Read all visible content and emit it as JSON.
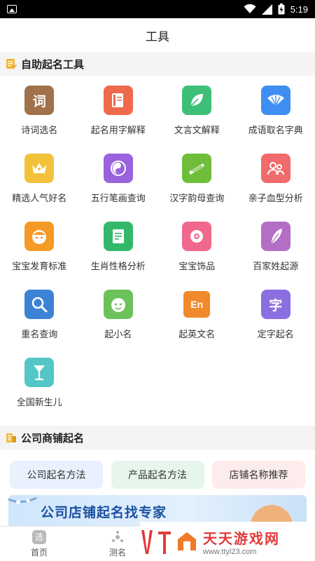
{
  "status_bar": {
    "time": "5:19"
  },
  "app_bar": {
    "title": "工具"
  },
  "section_self": {
    "title": "自助起名工具",
    "tools": [
      {
        "label": "诗词选名",
        "glyph": "词",
        "color": "#a0714a",
        "icon": "book-icon"
      },
      {
        "label": "起名用字解释",
        "glyph": "",
        "color": "#ef6a4c",
        "icon": "dictionary-icon"
      },
      {
        "label": "文言文解释",
        "glyph": "",
        "color": "#3ebf77",
        "icon": "leaf-icon"
      },
      {
        "label": "成语取名字典",
        "glyph": "",
        "color": "#3f8ef2",
        "icon": "fan-icon"
      },
      {
        "label": "精选人气好名",
        "glyph": "",
        "color": "#f3c23b",
        "icon": "crown-icon"
      },
      {
        "label": "五行笔画查询",
        "glyph": "",
        "color": "#9a63dd",
        "icon": "bagua-icon"
      },
      {
        "label": "汉字韵母查询",
        "glyph": "",
        "color": "#6fbe3b",
        "icon": "zither-icon"
      },
      {
        "label": "亲子血型分析",
        "glyph": "",
        "color": "#f06b6b",
        "icon": "family-icon"
      },
      {
        "label": "宝宝发育标准",
        "glyph": "",
        "color": "#f59a27",
        "icon": "baby-face-icon"
      },
      {
        "label": "生肖性格分析",
        "glyph": "",
        "color": "#33b86a",
        "icon": "document-icon"
      },
      {
        "label": "宝宝饰品",
        "glyph": "",
        "color": "#f0688c",
        "icon": "ornament-icon"
      },
      {
        "label": "百家姓起源",
        "glyph": "",
        "color": "#b36ec6",
        "icon": "feather-icon"
      },
      {
        "label": "重名查询",
        "glyph": "",
        "color": "#3c83d6",
        "icon": "magnifier-icon"
      },
      {
        "label": "起小名",
        "glyph": "",
        "color": "#6cc25a",
        "icon": "child-face-icon"
      },
      {
        "label": "起英文名",
        "glyph": "En",
        "color": "#f08a2c",
        "icon": "english-icon"
      },
      {
        "label": "定字起名",
        "glyph": "字",
        "color": "#8b6fe0",
        "icon": "character-icon"
      },
      {
        "label": "全国新生儿",
        "glyph": "",
        "color": "#54c6c6",
        "icon": "goblet-icon"
      }
    ]
  },
  "section_company": {
    "title": "公司商铺起名",
    "chips": [
      {
        "label": "公司起名方法",
        "bg": "#e8f1fd"
      },
      {
        "label": "产品起名方法",
        "bg": "#e6f6ec"
      },
      {
        "label": "店铺名称推荐",
        "bg": "#fdecec"
      }
    ]
  },
  "banner": {
    "text": "公司店铺起名找专家"
  },
  "tabbar": {
    "items": [
      {
        "label": "首页",
        "glyph": "选"
      },
      {
        "label": "测名",
        "glyph": ""
      },
      {
        "label": "",
        "glyph": ""
      },
      {
        "label": "",
        "glyph": ""
      }
    ]
  },
  "watermark": {
    "title": "天天游戏网",
    "url": "www.ttyl23.com"
  }
}
